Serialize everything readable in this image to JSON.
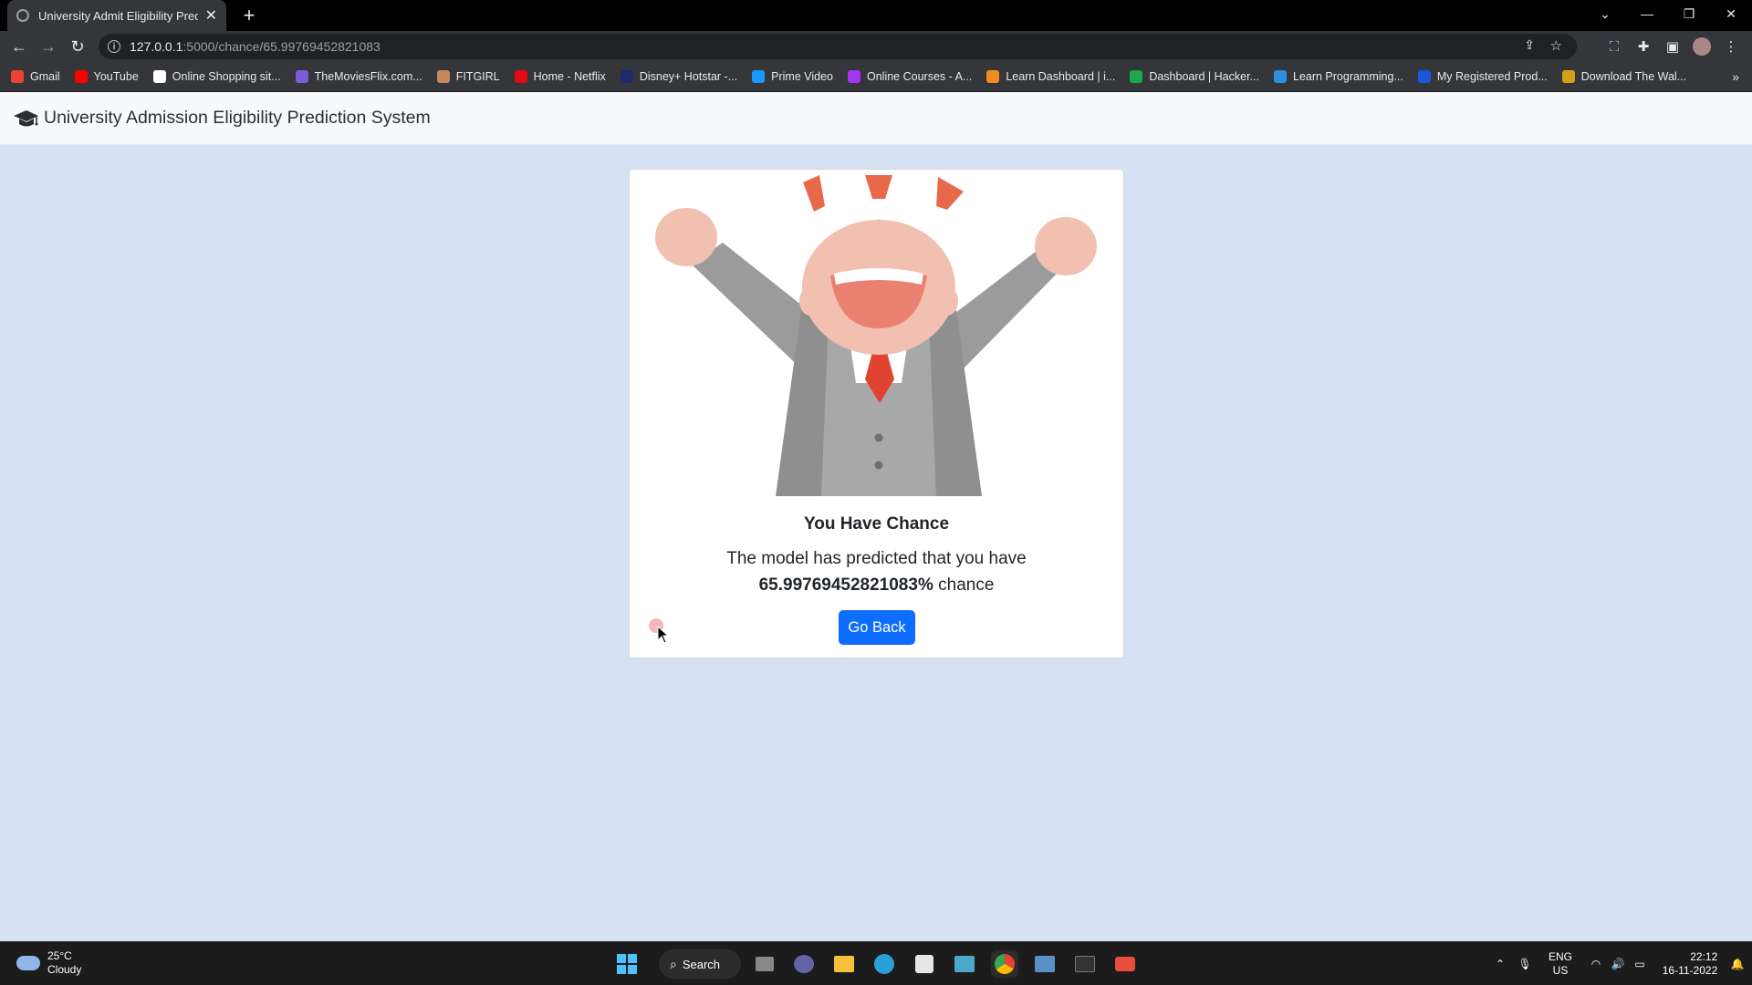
{
  "browser": {
    "tab_title": "University Admit Eligibility Predic",
    "url_host": "127.0.0.1",
    "url_path": ":5000/chance/65.99769452821083",
    "bookmarks": [
      {
        "label": "Gmail",
        "color": "#ea4335"
      },
      {
        "label": "YouTube",
        "color": "#ff0000"
      },
      {
        "label": "Online Shopping sit...",
        "color": "#ffffff"
      },
      {
        "label": "TheMoviesFlix.com...",
        "color": "#7b5cd6"
      },
      {
        "label": "FITGIRL",
        "color": "#c7875a"
      },
      {
        "label": "Home - Netflix",
        "color": "#e50914"
      },
      {
        "label": "Disney+ Hotstar -...",
        "color": "#1f2a6b"
      },
      {
        "label": "Prime Video",
        "color": "#1a98ff"
      },
      {
        "label": "Online Courses - A...",
        "color": "#a435f0"
      },
      {
        "label": "Learn Dashboard | i...",
        "color": "#f28b20"
      },
      {
        "label": "Dashboard | Hacker...",
        "color": "#1ba94c"
      },
      {
        "label": "Learn Programming...",
        "color": "#2f8fdd"
      },
      {
        "label": "My Registered Prod...",
        "color": "#1a56db"
      },
      {
        "label": "Download The Wal...",
        "color": "#d4a017"
      }
    ]
  },
  "app": {
    "brand": "University Admission Eligibility Prediction System"
  },
  "result": {
    "title": "You Have Chance",
    "line1": "The model has predicted that you have",
    "percent": "65.99769452821083%",
    "suffix": "chance",
    "button": "Go Back"
  },
  "taskbar": {
    "temp": "25°C",
    "condition": "Cloudy",
    "search": "Search",
    "lang1": "ENG",
    "lang2": "US",
    "time": "22:12",
    "date": "16-11-2022"
  },
  "colors": {
    "primary": "#0d6efd",
    "page_bg": "#d6e2f4"
  }
}
